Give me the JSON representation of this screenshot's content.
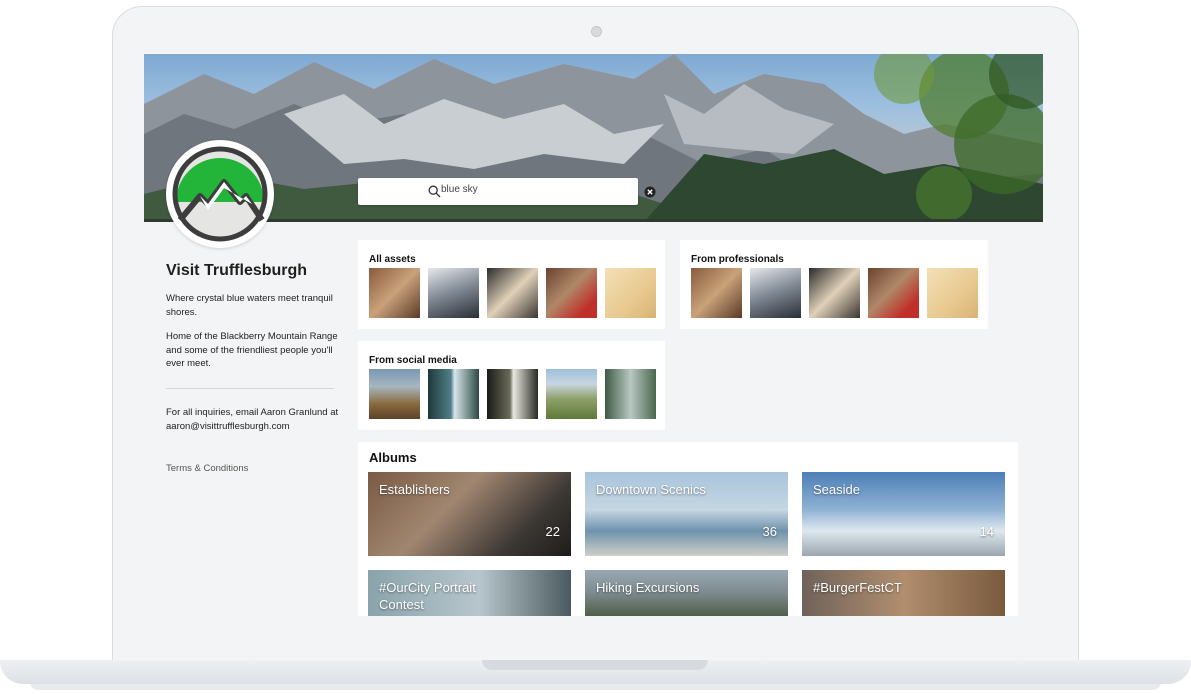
{
  "search": {
    "query": "blue sky"
  },
  "sidebar": {
    "title": "Visit Trufflesburgh",
    "tagline": "Where crystal blue waters meet tranquil shores.",
    "description": "Home of the Blackberry Mountain Range and some of the friendliest people you'll ever meet.",
    "contact": "For all inquiries, email Aaron Granlund at aaron@visittrufflesburgh.com",
    "terms_link": "Terms & Conditions"
  },
  "sections": {
    "all_assets": {
      "title": "All assets"
    },
    "from_professionals": {
      "title": "From professionals"
    },
    "from_social_media": {
      "title": "From social media"
    }
  },
  "albums": {
    "title": "Albums",
    "items": [
      {
        "name": "Establishers",
        "count": "22"
      },
      {
        "name": "Downtown Scenics",
        "count": "36"
      },
      {
        "name": "Seaside",
        "count": "14"
      },
      {
        "name": "#OurCity Portrait Contest",
        "count": ""
      },
      {
        "name": "Hiking Excursions",
        "count": ""
      },
      {
        "name": "#BurgerFestCT",
        "count": ""
      }
    ]
  },
  "colors": {
    "logo_green": "#22b53a",
    "logo_dark": "#3d3d3d",
    "card_bg": "#ffffff",
    "page_bg": "#f3f4f5"
  }
}
